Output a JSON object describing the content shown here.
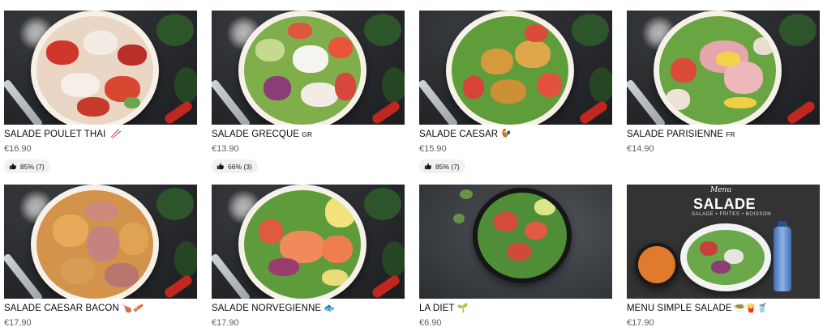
{
  "products": [
    {
      "id": "p1",
      "name": "SALADE POULET THAI",
      "suffix": "",
      "emoji": "🥢",
      "price": "€16.90",
      "rating": "85% (7)",
      "has_rating": true
    },
    {
      "id": "p2",
      "name": "SALADE GRECQUE",
      "suffix": "GR",
      "emoji": "",
      "price": "€13.90",
      "rating": "66% (3)",
      "has_rating": true
    },
    {
      "id": "p3",
      "name": "SALADE CAESAR",
      "suffix": "",
      "emoji": "🐓",
      "price": "€15.90",
      "rating": "85% (7)",
      "has_rating": true
    },
    {
      "id": "p4",
      "name": "SALADE PARISIENNE",
      "suffix": "FR",
      "emoji": "",
      "price": "€14.90",
      "rating": "",
      "has_rating": false
    },
    {
      "id": "p5",
      "name": "SALADE CAESAR BACON",
      "suffix": "",
      "emoji": "🍗🥓",
      "price": "€17.90",
      "rating": "",
      "has_rating": false
    },
    {
      "id": "p6",
      "name": "SALADE NORVEGIENNE",
      "suffix": "",
      "emoji": "🐟",
      "price": "€17.90",
      "rating": "",
      "has_rating": false
    },
    {
      "id": "p7",
      "name": "LA DIET",
      "suffix": "",
      "emoji": "🌱",
      "price": "€6.90",
      "rating": "",
      "has_rating": false
    },
    {
      "id": "p8",
      "name": "MENU SIMPLE SALADE",
      "suffix": "",
      "emoji": "🥗🍟🥤",
      "price": "€17.90",
      "rating": "",
      "has_rating": false
    }
  ],
  "menu_image": {
    "script": "Menu",
    "title": "SALADE",
    "subtitle": "SALADE • FRITES • BOISSON"
  },
  "colors": {
    "text": "#0b0b0b",
    "price": "#5e5e5e",
    "rating_bg": "#f1f1f1",
    "board": "#2b2d30"
  },
  "icons": {
    "rating": "thumb-up-icon"
  }
}
